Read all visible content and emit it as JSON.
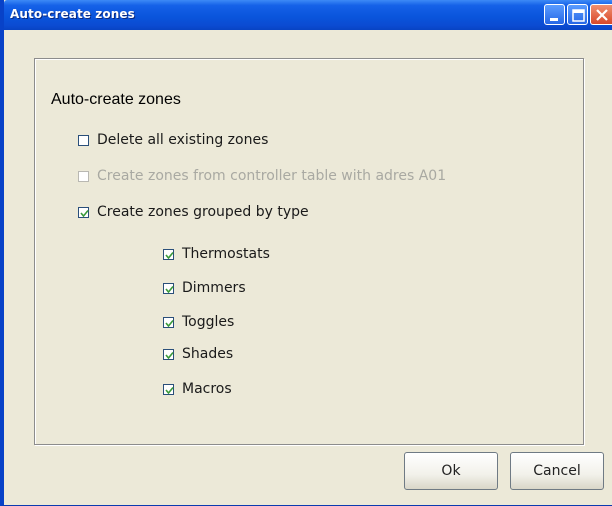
{
  "window": {
    "title": "Auto-create zones"
  },
  "dialog": {
    "heading": "Auto-create zones",
    "options": [
      {
        "label": "Delete all existing zones",
        "checked": false,
        "enabled": true
      },
      {
        "label": "Create zones from controller table with adres A01",
        "checked": false,
        "enabled": false
      },
      {
        "label": "Create zones grouped by type",
        "checked": true,
        "enabled": true
      }
    ],
    "types": [
      {
        "label": "Thermostats",
        "checked": true
      },
      {
        "label": "Dimmers",
        "checked": true
      },
      {
        "label": "Toggles",
        "checked": true
      },
      {
        "label": "Shades",
        "checked": true
      },
      {
        "label": "Macros",
        "checked": true
      }
    ]
  },
  "buttons": {
    "ok_label": "Ok",
    "cancel_label": "Cancel"
  },
  "colors": {
    "titlebar": "#0a55dc",
    "face": "#ece9d8",
    "disabled_text": "#a9a9a2",
    "check": "#3a9a3a"
  },
  "icons": {
    "minimize": "minimize-icon",
    "maximize": "maximize-icon",
    "close": "close-icon",
    "check": "checkmark-icon"
  }
}
